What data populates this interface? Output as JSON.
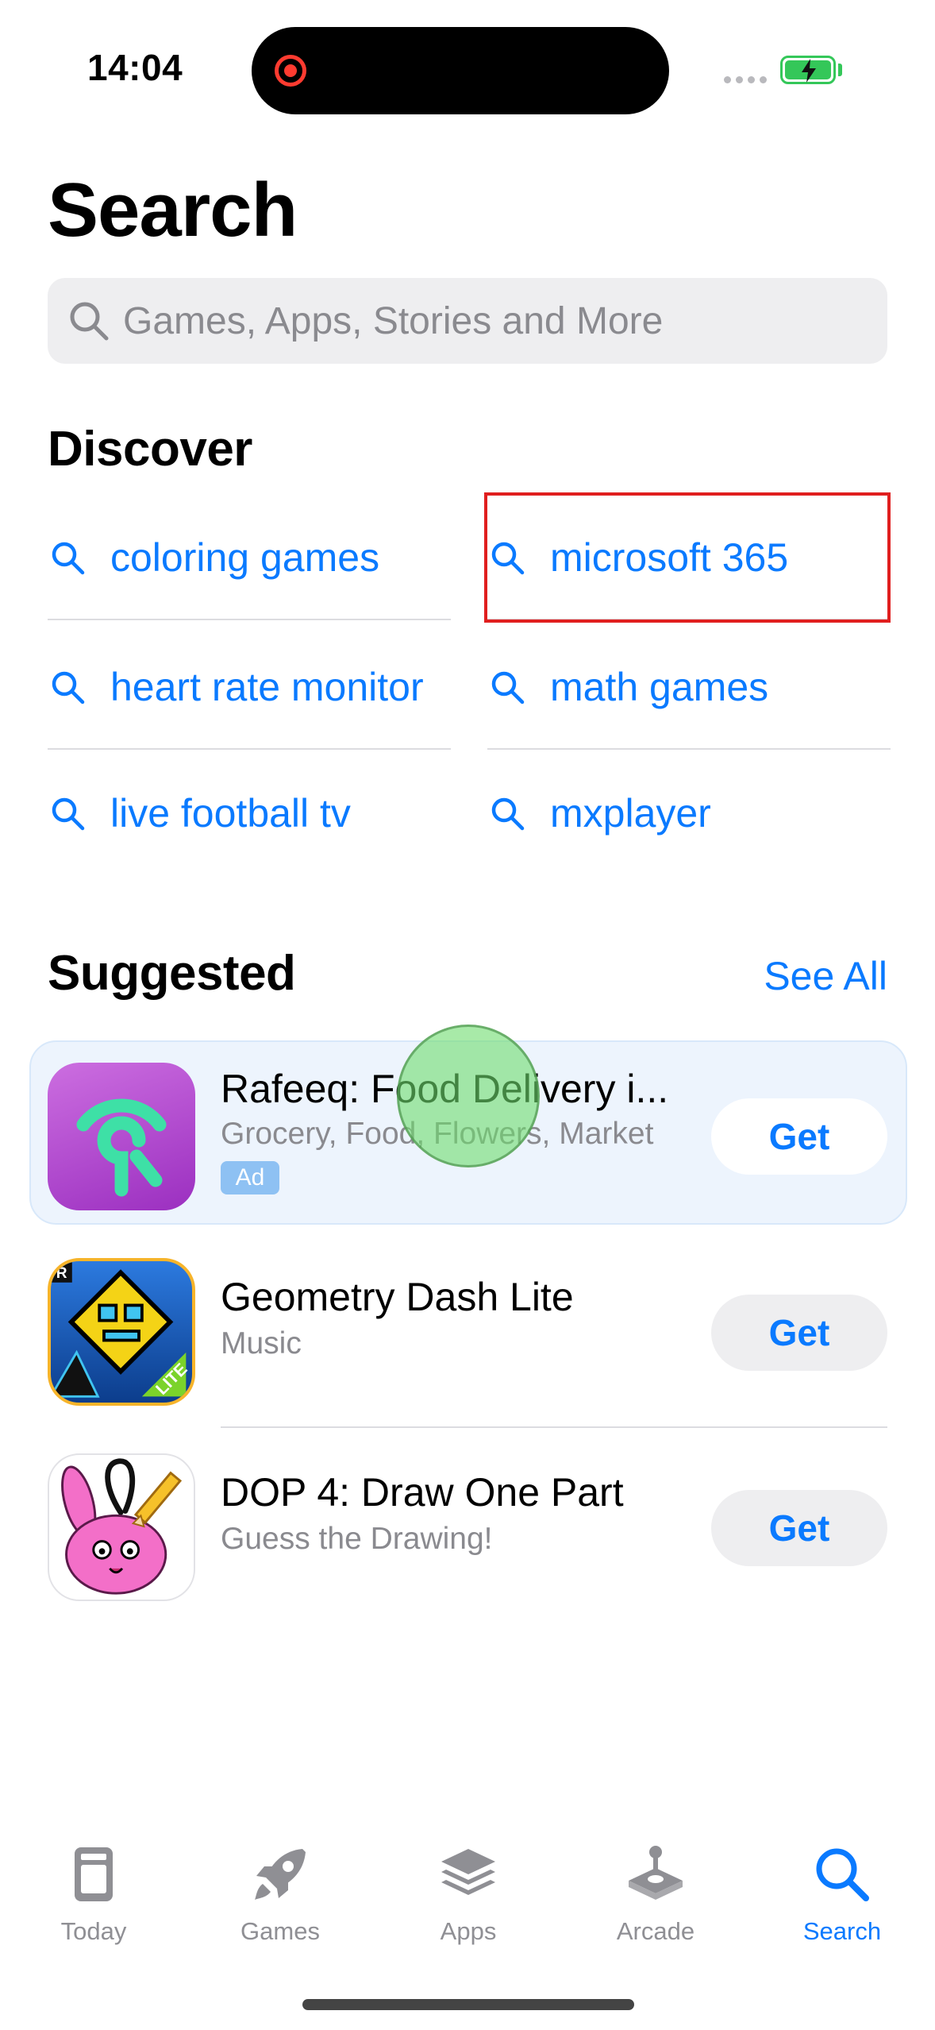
{
  "status_bar": {
    "time": "14:04"
  },
  "header": {
    "title": "Search"
  },
  "search": {
    "placeholder": "Games, Apps, Stories and More"
  },
  "discover": {
    "title": "Discover",
    "items": [
      {
        "label": "coloring games"
      },
      {
        "label": "microsoft 365"
      },
      {
        "label": "heart rate monitor"
      },
      {
        "label": "math games"
      },
      {
        "label": "live football tv"
      },
      {
        "label": "mxplayer"
      }
    ]
  },
  "suggested": {
    "title": "Suggested",
    "see_all": "See All",
    "apps": [
      {
        "name": "Rafeeq: Food Delivery i...",
        "subtitle": "Grocery, Food, Flowers, Market",
        "badge": "Ad",
        "button": "Get"
      },
      {
        "name": "Geometry Dash Lite",
        "subtitle": "Music",
        "button": "Get"
      },
      {
        "name": "DOP 4: Draw One Part",
        "subtitle": "Guess the Drawing!",
        "button": "Get"
      }
    ]
  },
  "tab_bar": {
    "tabs": [
      {
        "label": "Today",
        "icon": "today-icon"
      },
      {
        "label": "Games",
        "icon": "rocket-icon"
      },
      {
        "label": "Apps",
        "icon": "layers-icon"
      },
      {
        "label": "Arcade",
        "icon": "joystick-icon"
      },
      {
        "label": "Search",
        "icon": "search-icon",
        "active": true
      }
    ]
  },
  "colors": {
    "accent": "#0a7aff",
    "highlight": "#e01e1e",
    "battery": "#34c759"
  }
}
